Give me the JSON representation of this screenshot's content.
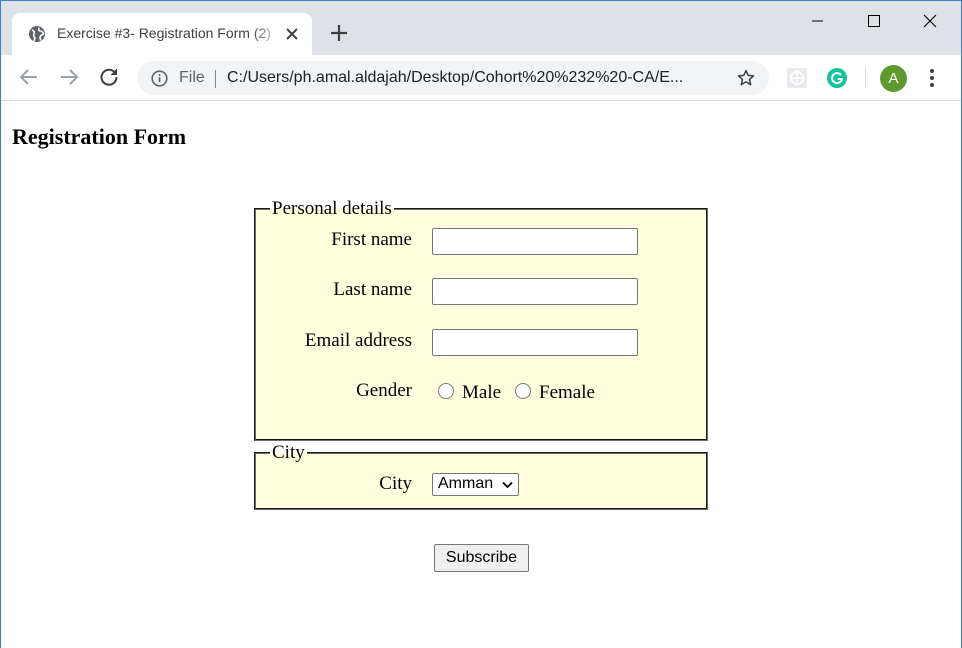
{
  "browser": {
    "tab": {
      "title": "Exercise #3- Registration Form (2)"
    },
    "address_bar": {
      "scheme_label": "File",
      "url": "C:/Users/ph.amal.aldajah/Desktop/Cohort%20%232%20-CA/E..."
    },
    "profile_initial": "A"
  },
  "page": {
    "title": "Registration Form",
    "personal_details": {
      "legend": "Personal details",
      "first_name": {
        "label": "First name",
        "value": ""
      },
      "last_name": {
        "label": "Last name",
        "value": ""
      },
      "email": {
        "label": "Email address",
        "value": ""
      },
      "gender": {
        "label": "Gender",
        "options": [
          "Male",
          "Female"
        ],
        "selected": null
      }
    },
    "city_section": {
      "legend": "City",
      "city": {
        "label": "City",
        "selected": "Amman"
      }
    },
    "subscribe_label": "Subscribe"
  },
  "colors": {
    "fieldset_background": "#ffffe0",
    "tabstrip_background": "#dee1e6",
    "avatar_background": "#5f9a2f"
  }
}
